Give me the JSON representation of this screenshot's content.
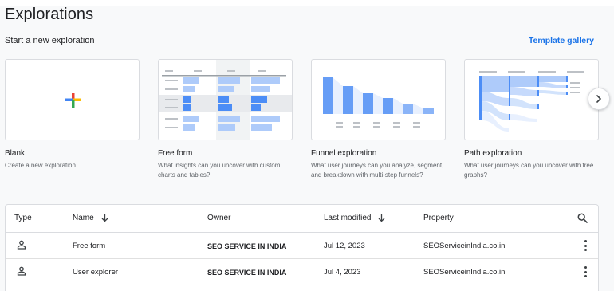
{
  "header": {
    "title": "Explorations",
    "subtitle": "Start a new exploration",
    "template_gallery": "Template gallery"
  },
  "cards": [
    {
      "title": "Blank",
      "desc": "Create a new exploration"
    },
    {
      "title": "Free form",
      "desc": "What insights can you uncover with custom charts and tables?"
    },
    {
      "title": "Funnel exploration",
      "desc": "What user journeys can you analyze, segment, and breakdown with multi-step funnels?"
    },
    {
      "title": "Path exploration",
      "desc": "What user journeys can you uncover with tree graphs?"
    }
  ],
  "table": {
    "headers": {
      "type": "Type",
      "name": "Name",
      "owner": "Owner",
      "last_modified": "Last modified",
      "property": "Property"
    },
    "rows": [
      {
        "name": "Free form",
        "owner": "SEO SERVICE IN INDIA",
        "last_modified": "Jul 12, 2023",
        "property": "SEOServiceinIndia.co.in"
      },
      {
        "name": "User explorer",
        "owner": "SEO SERVICE IN INDIA",
        "last_modified": "Jul 4, 2023",
        "property": "SEOServiceinIndia.co.in"
      }
    ]
  },
  "icons": {
    "next": "chevron-right-icon",
    "search": "search-icon",
    "sort": "arrow-down-icon",
    "more": "more-vert-icon",
    "type": "person-icon"
  },
  "colors": {
    "accent": "#1a73e8",
    "google_blue": "#4285f4",
    "google_red": "#ea4335",
    "google_yellow": "#fbbc04",
    "google_green": "#34a853",
    "chart_blue": "#4c8df6",
    "chart_light_blue": "#aecbfa"
  }
}
